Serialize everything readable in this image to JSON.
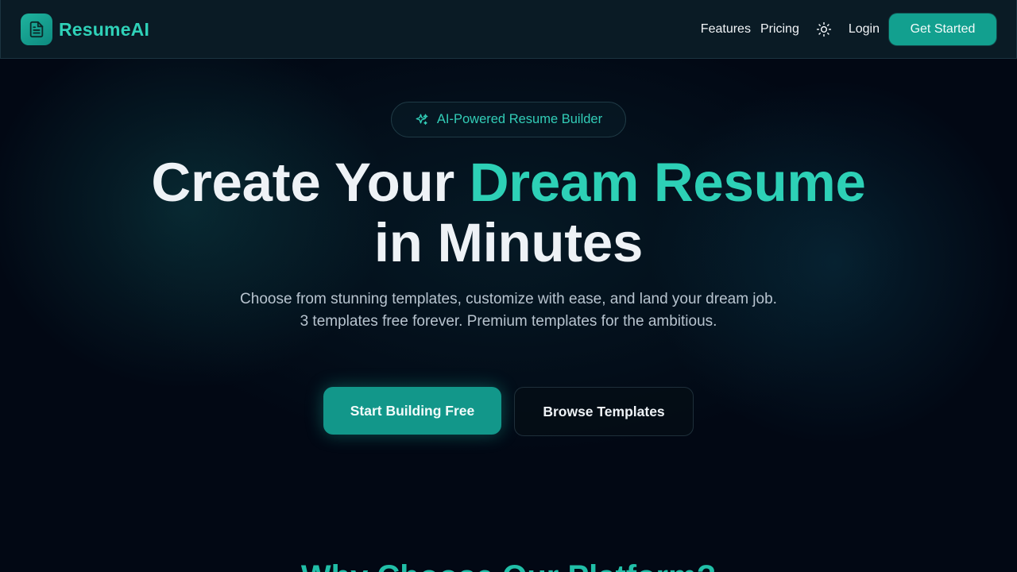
{
  "header": {
    "brand_name": "ResumeAI",
    "brand_icon": "document-icon",
    "nav": {
      "features": "Features",
      "pricing": "Pricing",
      "login": "Login",
      "get_started": "Get Started"
    },
    "theme_toggle_icon": "sun-icon"
  },
  "hero": {
    "badge": {
      "icon": "sparkles-icon",
      "text": "AI-Powered Resume Builder"
    },
    "headline": {
      "part1": "Create Your ",
      "accent": "Dream Resume",
      "part2": "in Minutes"
    },
    "subtitle": "Choose from stunning templates, customize with ease, and land your dream job. 3 templates free forever. Premium templates for the ambitious.",
    "primary_button": "Start Building Free",
    "secondary_button": "Browse Templates"
  },
  "features_section": {
    "title": "Why Choose Our Platform?"
  },
  "colors": {
    "accent": "#2dd0b6",
    "primary_button": "#12978a",
    "background": "#020814",
    "navbar": "#0a1b25"
  }
}
